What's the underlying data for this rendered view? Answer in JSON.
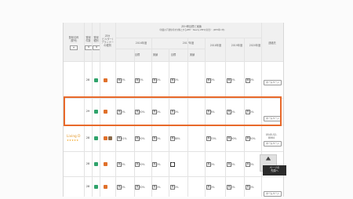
{
  "header": {
    "col_member_name": "登録名称\n(屋号)",
    "col_count_label": "登録\n件数",
    "col_badge_label": "登録\n種別",
    "col_zeh_builder": "ZEH\nビルダー/\nプランナー\nの種別",
    "col_target_title": "ZEH率目標と実績",
    "col_target_sub": "〈新築の戸建住宅を対象とするZEH・Nearly ZEHの割合〉 (ZEH率=中)",
    "col_fy2016": "2016年度",
    "col_fy2017": "2017年度",
    "col_fy2018": "2018年度",
    "col_fy2019": "2019年度",
    "col_fy2020": "2020年度",
    "col_target": "目標",
    "col_result": "実績",
    "col_contact": "連絡先",
    "sort_asc": "▲",
    "sort_desc": "▼"
  },
  "rows": [
    {
      "name": "",
      "stars": "",
      "count": "28",
      "badge1": "",
      "badge2": "",
      "badge3": "",
      "values": [
        "0%",
        "0%",
        "0%",
        "0%",
        "0%",
        "0%",
        "0%"
      ],
      "marks": [
        "無",
        "無",
        "無",
        "無",
        "無",
        "無",
        "無"
      ],
      "contact": "",
      "homepage": "ホームページ"
    },
    {
      "name": "",
      "stars": "",
      "count": "29",
      "badge1": "",
      "badge2": "",
      "badge3": "",
      "values": [
        "0%",
        "50%",
        "0%",
        "0%",
        "8%",
        "0%",
        "0%"
      ],
      "marks": [
        "無",
        "無",
        "無",
        "無",
        "無",
        "無",
        "無"
      ],
      "contact": "",
      "homepage": "ホームページ"
    },
    {
      "name": "Living D",
      "stars": "★★★★★",
      "count": "28",
      "badge1": "",
      "badge2": "",
      "badge3": "",
      "values": [
        "41%",
        "50%",
        "0%",
        "88%",
        "70%",
        "90%",
        "50%"
      ],
      "marks": [
        "無",
        "無",
        "無",
        "無",
        "無",
        "無",
        "無"
      ],
      "contact": "0545-52-\n8064",
      "homepage": "ホームページ"
    },
    {
      "name": "",
      "stars": "",
      "count": "28",
      "badge1": "",
      "badge2": "",
      "badge3": "",
      "values": [
        "0%",
        "50%",
        "0%",
        "",
        "0%",
        "0%",
        "0%"
      ],
      "marks": [
        "無",
        "無",
        "無",
        "黒",
        "無",
        "無",
        "無"
      ],
      "contact": "",
      "homepage": "ホームページ"
    },
    {
      "name": "",
      "stars": "",
      "count": "28",
      "badge1": "",
      "badge2": "",
      "badge3": "",
      "values": [
        "0%",
        "50%",
        "0%",
        "0%",
        "0%",
        "0%",
        "0%"
      ],
      "marks": [
        "無",
        "無",
        "無",
        "無",
        "無",
        "無",
        "無"
      ],
      "contact": "",
      "homepage": "ホームページ"
    },
    {
      "name": "",
      "stars": "",
      "count": "28",
      "badge1": "",
      "badge2": "",
      "badge3": "",
      "values": [
        "0%",
        "50%",
        "0%",
        "0%",
        "0%",
        "0%",
        "0%"
      ],
      "marks": [
        "無",
        "無",
        "無",
        "無",
        "無",
        "無",
        "無"
      ],
      "contact": "",
      "homepage": ""
    }
  ],
  "scroll_top": {
    "label": "ページの\n先頭へ"
  },
  "colors": {
    "highlight": "#e8692a",
    "green": "#2fa36b",
    "orange": "#e0702a",
    "star": "#f0a31c"
  }
}
